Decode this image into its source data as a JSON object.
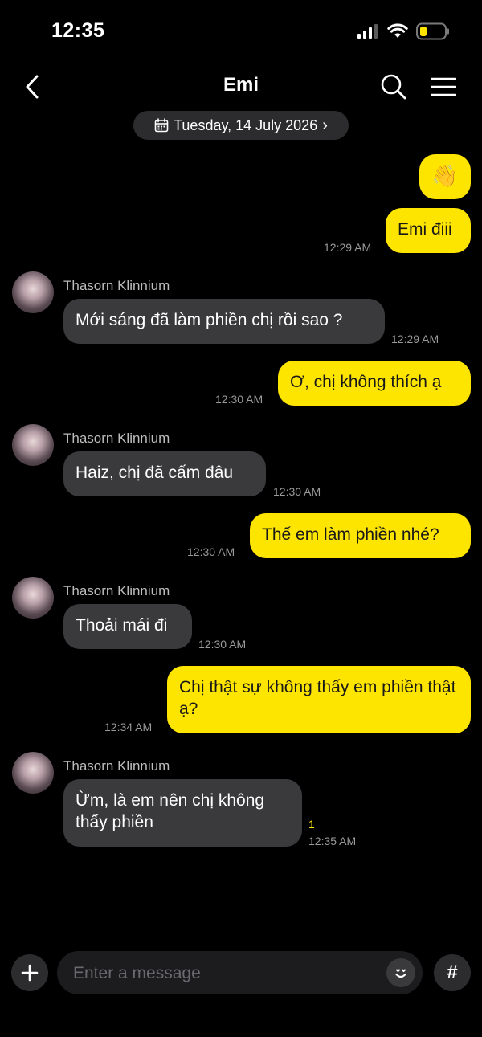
{
  "status_bar": {
    "time": "12:35",
    "icons": [
      "cellular-signal-icon",
      "wifi-icon",
      "battery-low-icon"
    ]
  },
  "header": {
    "title": "Emi",
    "icons": [
      "chevron-left-icon",
      "search-icon",
      "menu-icon"
    ]
  },
  "date_chip": {
    "icon": "calendar-icon",
    "text": "Tuesday, 14 July 2026",
    "arrow": "›"
  },
  "colors": {
    "outgoing_bubble": "#fee500",
    "incoming_bubble": "#3a3a3c",
    "background": "#000000",
    "unread_count": "#fee500"
  },
  "messages": [
    {
      "direction": "out",
      "text": "👋",
      "time": ""
    },
    {
      "direction": "out",
      "text": "Emi điii",
      "time": "12:29 AM"
    },
    {
      "direction": "in",
      "sender": "Thasorn Klinnium",
      "text": "Mới sáng đã làm phiền chị rồi sao ?",
      "time": "12:29 AM"
    },
    {
      "direction": "out",
      "text": "Ơ, chị không thích ạ",
      "time": "12:30 AM"
    },
    {
      "direction": "in",
      "sender": "Thasorn Klinnium",
      "text": "Haiz, chị đã cấm đâu",
      "time": "12:30 AM"
    },
    {
      "direction": "out",
      "text": "Thế em làm phiền nhé?",
      "time": "12:30 AM"
    },
    {
      "direction": "in",
      "sender": "Thasorn Klinnium",
      "text": "Thoải mái đi",
      "time": "12:30 AM"
    },
    {
      "direction": "out",
      "text": "Chị thật sự không thấy em phiền thật ạ?",
      "time": "12:34 AM"
    },
    {
      "direction": "in",
      "sender": "Thasorn Klinnium",
      "text": "Ừm, là em nên chị không thấy phiền",
      "time": "12:35 AM",
      "unread": "1"
    }
  ],
  "composer": {
    "placeholder": "Enter a message",
    "icons": [
      "plus-icon",
      "emoji-icon",
      "hash-icon"
    ],
    "hash_glyph": "#"
  }
}
